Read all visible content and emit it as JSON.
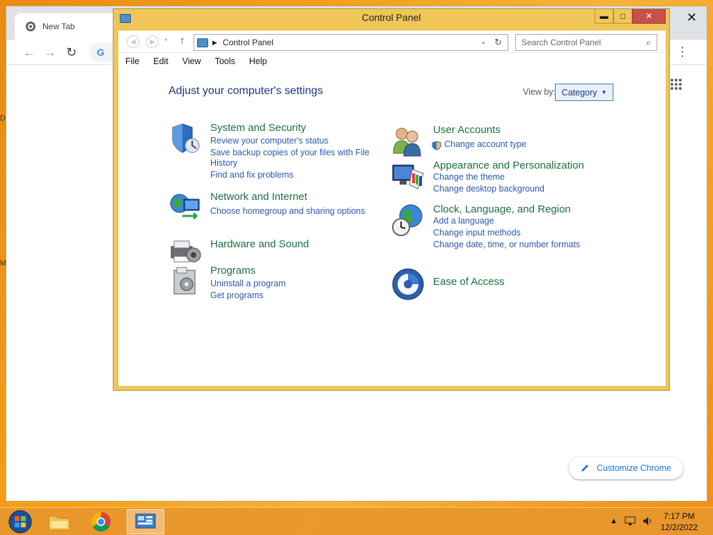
{
  "chrome": {
    "tab_title": "New Tab",
    "close_glyph": "✕",
    "back_glyph": "←",
    "forward_glyph": "→",
    "reload_glyph": "↻",
    "google_letter": "G",
    "customize_label": "Customize Chrome",
    "side_letters": [
      "D",
      "M"
    ]
  },
  "control_panel": {
    "title": "Control Panel",
    "window_buttons": {
      "minimize": "▬",
      "maximize": "□",
      "close": "✕"
    },
    "address_text": "Control Panel",
    "search_placeholder": "Search Control Panel",
    "menu": [
      "File",
      "Edit",
      "View",
      "Tools",
      "Help"
    ],
    "heading": "Adjust your computer's settings",
    "view_by_label": "View by:",
    "view_by_value": "Category",
    "categories": [
      {
        "title": "System and Security",
        "links": [
          "Review your computer's status",
          "Save backup copies of your files with File",
          "History",
          "Find and fix problems"
        ]
      },
      {
        "title": "Network and Internet",
        "links": [
          "Choose homegroup and sharing options"
        ]
      },
      {
        "title": "Hardware and Sound",
        "links": []
      },
      {
        "title": "Programs",
        "links": [
          "Uninstall a program",
          "Get programs"
        ]
      },
      {
        "title": "User Accounts",
        "links": [
          "Change account type"
        ]
      },
      {
        "title": "Appearance and Personalization",
        "links": [
          "Change the theme",
          "Change desktop background"
        ]
      },
      {
        "title": "Clock, Language, and Region",
        "links": [
          "Add a language",
          "Change input methods",
          "Change date, time, or number formats"
        ]
      },
      {
        "title": "Ease of Access",
        "links": []
      }
    ]
  },
  "taskbar": {
    "time": "7:17 PM",
    "date": "12/2/2022",
    "tray_arrow": "▲"
  },
  "colors": {
    "category_title": "#1b6f3d",
    "link": "#2a58ad",
    "heading": "#1e3287",
    "window_frame": "#f0c659"
  }
}
